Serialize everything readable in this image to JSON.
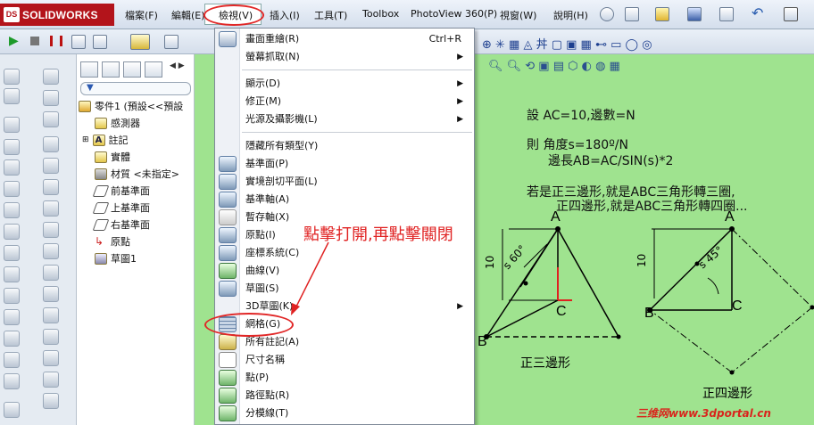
{
  "app": {
    "logo_text": "SOLIDWORKS",
    "logo_mark": "DS"
  },
  "menubar": {
    "items": [
      "檔案(F)",
      "編輯(E)",
      "檢視(V)",
      "插入(I)",
      "工具(T)",
      "Toolbox",
      "PhotoView 360(P)",
      "視窗(W)",
      "說明(H)"
    ]
  },
  "tree": {
    "root": "零件1 (預設<<預設",
    "items": [
      "感測器",
      "註記",
      "實體",
      "材質 <未指定>",
      "前基準面",
      "上基準面",
      "右基準面",
      "原點",
      "草圖1"
    ]
  },
  "view_menu": {
    "items": [
      {
        "label": "畫面重繪(R)",
        "shortcut": "Ctrl+R",
        "icon": "redraw-icon"
      },
      {
        "label": "螢幕抓取(N)",
        "submenu": true
      },
      {
        "label": "顯示(D)",
        "submenu": true
      },
      {
        "label": "修正(M)",
        "submenu": true
      },
      {
        "label": "光源及攝影機(L)",
        "submenu": true
      },
      {
        "label": "隱藏所有類型(Y)"
      },
      {
        "label": "基準面(P)",
        "icon": "plane-icon"
      },
      {
        "label": "實境剖切平面(L)",
        "icon": "section-plane-icon"
      },
      {
        "label": "基準軸(A)",
        "icon": "axis-icon"
      },
      {
        "label": "暫存軸(X)",
        "icon": "temp-axis-icon"
      },
      {
        "label": "原點(I)",
        "icon": "origin-icon"
      },
      {
        "label": "座標系統(C)",
        "icon": "coordinate-system-icon"
      },
      {
        "label": "曲線(V)",
        "icon": "curve-icon"
      },
      {
        "label": "草圖(S)",
        "icon": "sketch-icon"
      },
      {
        "label": "3D草圖(K)",
        "submenu": true
      },
      {
        "label": "網格(G)",
        "icon": "grid-icon"
      },
      {
        "label": "所有註記(A)",
        "icon": "annotation-icon"
      },
      {
        "label": "尺寸名稱",
        "icon": "dimension-name-icon"
      },
      {
        "label": "點(P)",
        "icon": "point-icon"
      },
      {
        "label": "路徑點(R)",
        "icon": "route-point-icon"
      },
      {
        "label": "分模線(T)",
        "icon": "parting-line-icon"
      }
    ]
  },
  "annotation": {
    "callout": "點擊打開,再點擊關閉",
    "color": "#e02222"
  },
  "canvas": {
    "line1": "設  AC=10,邊數=N",
    "line2": "則    角度s=180º/N",
    "line3": "邊長AB=AC/SIN(s)*2",
    "line4": "若是正三邊形,就是ABC三角形轉三圈,",
    "line5": "正四邊形,就是ABC三角形轉四圈...",
    "tri": {
      "A": "A",
      "B": "B",
      "C": "C",
      "dim": "10",
      "angle": "s 60°",
      "caption": "正三邊形"
    },
    "sq": {
      "A": "A",
      "B": "B",
      "C": "C",
      "dim": "10",
      "angle": "s 45°",
      "caption": "正四邊形"
    },
    "watermark": "三维网www.3dportal.cn"
  },
  "colors": {
    "accent": "#e12727",
    "canvas_bg": "#9fe38f",
    "logo_bg": "#b3141b"
  }
}
